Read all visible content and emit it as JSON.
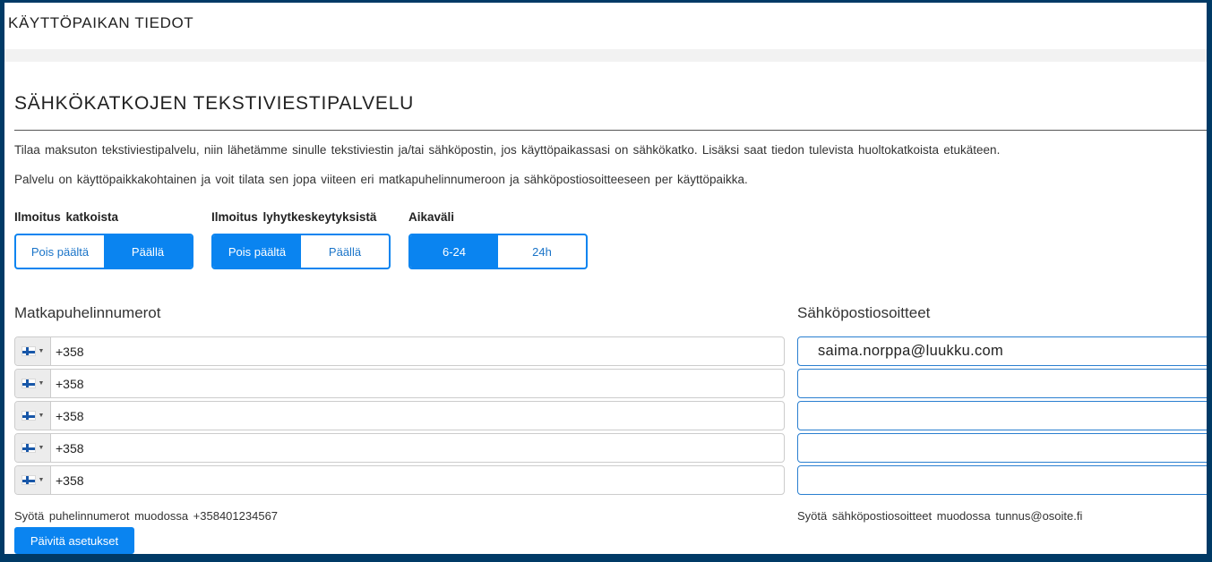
{
  "header": {
    "title": "KÄYTTÖPAIKAN TIEDOT"
  },
  "section": {
    "title": "SÄHKÖKATKOJEN TEKSTIVIESTIPALVELU",
    "paragraph1": "Tilaa maksuton tekstiviestipalvelu, niin lähetämme sinulle tekstiviestin ja/tai sähköpostin, jos käyttöpaikassasi on sähkökatko. Lisäksi saat tiedon tulevista huoltokatkoista etukäteen.",
    "paragraph2": "Palvelu on käyttöpaikkakohtainen ja voit tilata sen jopa viiteen eri matkapuhelinnumeroon ja sähköpostiosoitteeseen per käyttöpaikka."
  },
  "settings": {
    "outages": {
      "label": "Ilmoitus katkoista",
      "options": [
        "Pois päältä",
        "Päällä"
      ],
      "selected": "Päällä"
    },
    "short_interruptions": {
      "label": "Ilmoitus lyhytkeskeytyksistä",
      "options": [
        "Pois päältä",
        "Päällä"
      ],
      "selected": "Pois päältä"
    },
    "interval": {
      "label": "Aikaväli",
      "options": [
        "6-24",
        "24h"
      ],
      "selected": "6-24"
    }
  },
  "phones": {
    "title": "Matkapuhelinnumerot",
    "country_flag_icon": "finland-flag-icon",
    "items": [
      {
        "value": "+358"
      },
      {
        "value": "+358"
      },
      {
        "value": "+358"
      },
      {
        "value": "+358"
      },
      {
        "value": "+358"
      }
    ],
    "hint": "Syötä puhelinnumerot muodossa +358401234567"
  },
  "emails": {
    "title": "Sähköpostiosoitteet",
    "items": [
      {
        "value": "saima.norppa@luukku.com"
      },
      {
        "value": ""
      },
      {
        "value": ""
      },
      {
        "value": ""
      },
      {
        "value": ""
      }
    ],
    "hint": "Syötä sähköpostiosoitteet muodossa tunnus@osoite.fi"
  },
  "actions": {
    "update_label": "Päivitä asetukset"
  },
  "colors": {
    "accent": "#0a84f0",
    "frame": "#003a66"
  }
}
